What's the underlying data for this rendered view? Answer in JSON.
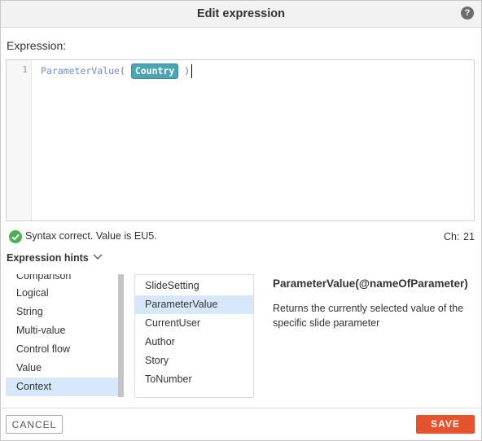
{
  "dialog": {
    "title": "Edit expression",
    "help_icon": "help-icon"
  },
  "editor": {
    "label": "Expression:",
    "line_number": "1",
    "function_name": "ParameterValue",
    "open_paren": "(",
    "parameter": "Country",
    "close_paren": ")"
  },
  "status": {
    "text": "Syntax correct. Value is EU5.",
    "icon": "check-circle-icon",
    "ch_label": "Ch:",
    "ch_value": "21",
    "color": "#4caf50"
  },
  "hints": {
    "header": "Expression hints",
    "chevron_icon": "chevron-down-icon",
    "categories": [
      {
        "label": "Comparison",
        "selected": false
      },
      {
        "label": "Logical",
        "selected": false
      },
      {
        "label": "String",
        "selected": false
      },
      {
        "label": "Multi-value",
        "selected": false
      },
      {
        "label": "Control flow",
        "selected": false
      },
      {
        "label": "Value",
        "selected": false
      },
      {
        "label": "Context",
        "selected": true
      }
    ],
    "functions": [
      {
        "label": "SlideSetting",
        "selected": false
      },
      {
        "label": "ParameterValue",
        "selected": true
      },
      {
        "label": "CurrentUser",
        "selected": false
      },
      {
        "label": "Author",
        "selected": false
      },
      {
        "label": "Story",
        "selected": false
      },
      {
        "label": "ToNumber",
        "selected": false
      }
    ],
    "description_title": "ParameterValue(@nameOfParameter)",
    "description_text": "Returns the currently selected value of the specific slide parameter"
  },
  "footer": {
    "cancel_label": "CANCEL",
    "save_label": "SAVE"
  },
  "colors": {
    "accent": "#e5532d",
    "selection": "#d6e8f9",
    "token": "#4aa6b2"
  }
}
